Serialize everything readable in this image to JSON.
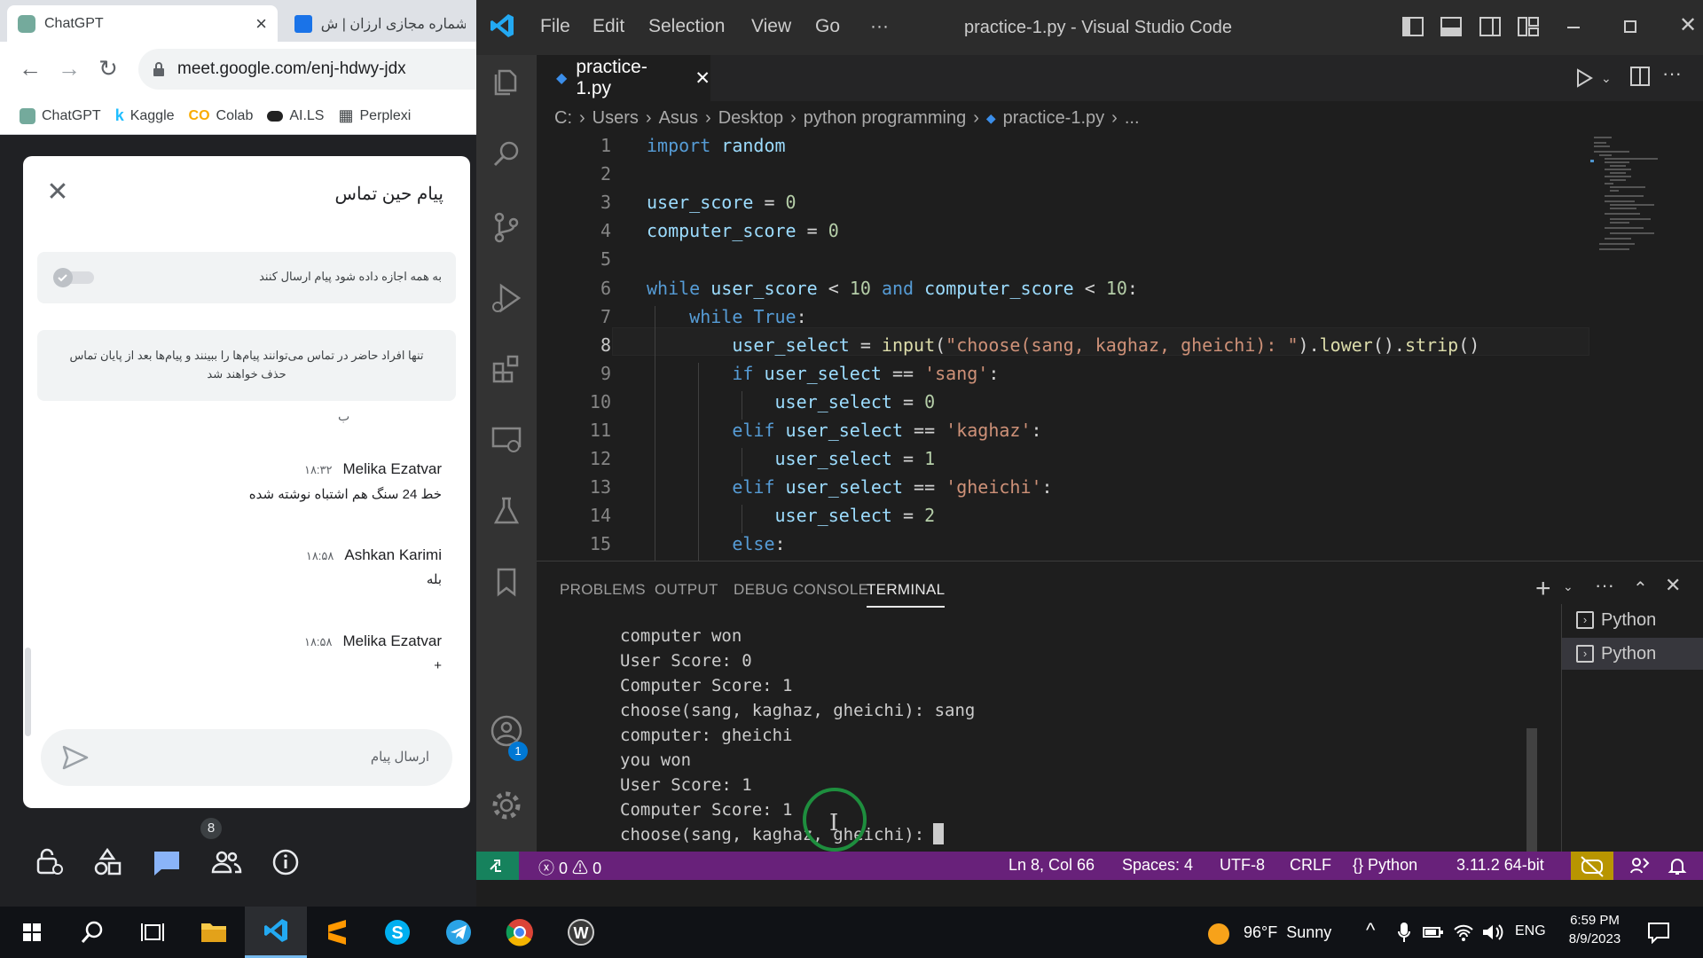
{
  "browser": {
    "tabs": [
      {
        "title": "ChatGPT",
        "close": "×"
      },
      {
        "title": "شماره مجازی ارزان | ش"
      }
    ],
    "url": "meet.google.com/enj-hdwy-jdx",
    "bookmarks": [
      "ChatGPT",
      "Kaggle",
      "Colab",
      "AI.LS",
      "Perplexi"
    ]
  },
  "meet_chat": {
    "title": "پیام حین تماس",
    "permission_label": "به همه اجازه داده شود پیام ارسال کنند",
    "notice": "تنها افراد حاضر در تماس می‌توانند پیام‌ها را ببینند و پیام‌ها بعد از پایان تماس حذف خواهند شد",
    "stray_text": "ب",
    "messages": [
      {
        "name": "Melika Ezatvar",
        "time": "۱۸:۳۲",
        "text": "خط 24 سنگ هم اشتباه نوشته شده"
      },
      {
        "name": "Ashkan Karimi",
        "time": "۱۸:۵۸",
        "text": "بله"
      },
      {
        "name": "Melika Ezatvar",
        "time": "۱۸:۵۸",
        "text": "+"
      }
    ],
    "composer_placeholder": "ارسال پیام",
    "participants_badge": "8"
  },
  "vscode": {
    "menu": [
      "File",
      "Edit",
      "Selection",
      "View",
      "Go",
      "···"
    ],
    "window_title": "practice-1.py - Visual Studio Code",
    "active_tab": "practice-1.py",
    "breadcrumb": [
      "C:",
      "Users",
      "Asus",
      "Desktop",
      "python programming",
      "practice-1.py",
      "..."
    ],
    "accounts_badge": "1",
    "code_lines": [
      "import random",
      "",
      "user_score = 0",
      "computer_score = 0",
      "",
      "while user_score < 10 and computer_score < 10:",
      "    while True:",
      "        user_select = input(\"choose(sang, kaghaz, gheichi): \").lower().strip()",
      "        if user_select == 'sang':",
      "            user_select = 0",
      "        elif user_select == 'kaghaz':",
      "            user_select = 1",
      "        elif user_select == 'gheichi':",
      "            user_select = 2",
      "        else:"
    ],
    "panel_tabs": [
      "PROBLEMS",
      "OUTPUT",
      "DEBUG CONSOLE",
      "TERMINAL"
    ],
    "terminal_lines": [
      "computer won",
      "User Score: 0",
      "Computer Score: 1",
      "choose(sang, kaghaz, gheichi): sang",
      "computer: gheichi",
      "you won",
      "User Score: 1",
      "Computer Score: 1",
      "choose(sang, kaghaz, gheichi): "
    ],
    "terminal_instances": [
      "Python",
      "Python"
    ],
    "status": {
      "errors": "0",
      "warnings": "0",
      "position": "Ln 8, Col 66",
      "spaces": "Spaces: 4",
      "encoding": "UTF-8",
      "eol": "CRLF",
      "language": "Python",
      "interpreter": "3.11.2 64-bit"
    },
    "colors": {
      "statusbar": "#68217a",
      "remote": "#16825d"
    }
  },
  "taskbar": {
    "weather": "96°F  Sunny",
    "language": "ENG",
    "time": "6:59 PM",
    "date": "8/9/2023"
  }
}
